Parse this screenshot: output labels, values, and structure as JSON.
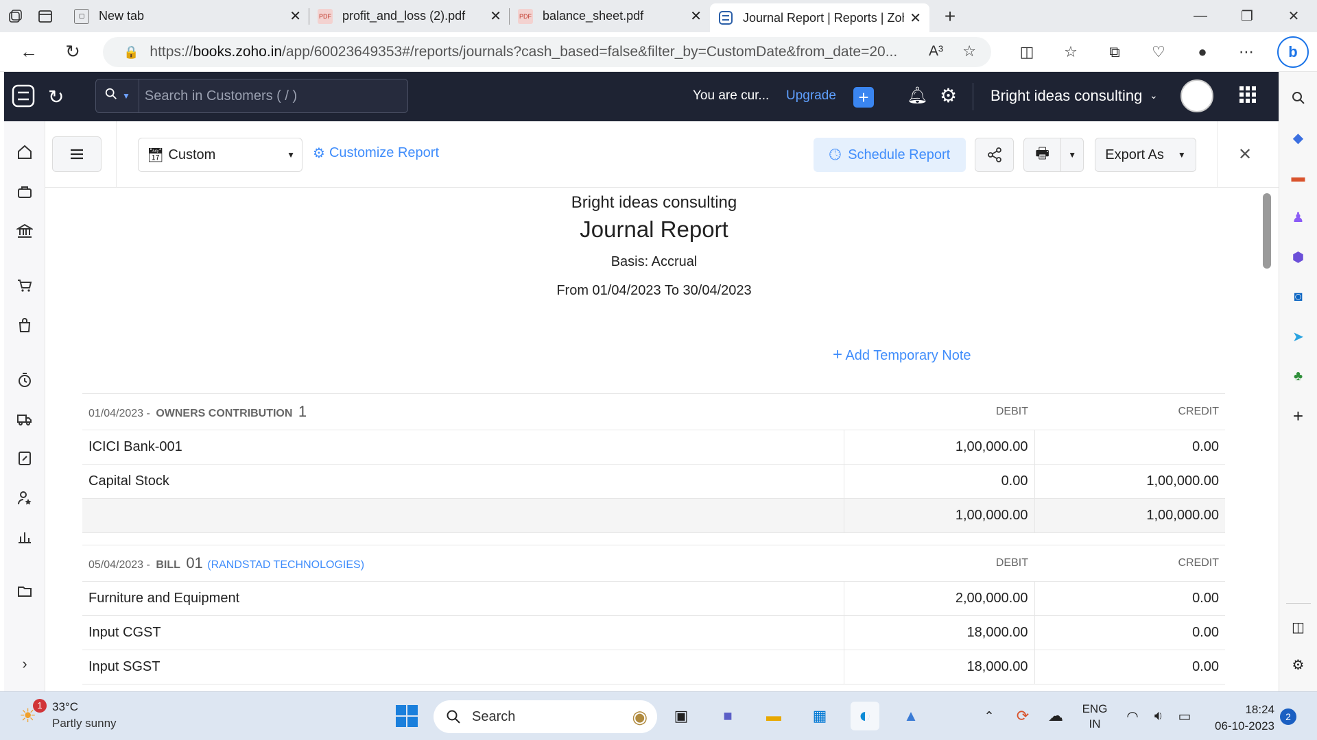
{
  "browser": {
    "tabs": [
      {
        "title": "New tab"
      },
      {
        "title": "profit_and_loss (2).pdf",
        "fav": "PDF"
      },
      {
        "title": "balance_sheet.pdf",
        "fav": "PDF"
      },
      {
        "title": "Journal Report | Reports | Zoho B"
      }
    ],
    "url_prefix": "https://",
    "url_domain": "books.zoho.in",
    "url_rest": "/app/60023649353#/reports/journals?cash_based=false&filter_by=CustomDate&from_date=20...",
    "read_aloud": "A³"
  },
  "app": {
    "search_placeholder": "Search in Customers ( / )",
    "trial_text": "You are cur...",
    "upgrade_label": "Upgrade",
    "org_name": "Bright ideas consulting"
  },
  "toolbar": {
    "date_filter": "Custom",
    "customize_label": "Customize Report",
    "schedule_label": "Schedule Report",
    "export_label": "Export As"
  },
  "report": {
    "org": "Bright ideas consulting",
    "title": "Journal Report",
    "basis": "Basis: Accrual",
    "period": "From 01/04/2023 To 30/04/2023",
    "add_note": "Add Temporary Note",
    "debit_header": "DEBIT",
    "credit_header": "CREDIT",
    "entries": [
      {
        "date": "01/04/2023 -",
        "type": "OWNERS CONTRIBUTION",
        "number": "1",
        "party": "",
        "rows": [
          {
            "account": "ICICI Bank-001",
            "debit": "1,00,000.00",
            "credit": "0.00"
          },
          {
            "account": "Capital Stock",
            "debit": "0.00",
            "credit": "1,00,000.00"
          }
        ],
        "total_debit": "1,00,000.00",
        "total_credit": "1,00,000.00"
      },
      {
        "date": "05/04/2023 -",
        "type": "BILL",
        "number": "01",
        "party": "(RANDSTAD TECHNOLOGIES)",
        "rows": [
          {
            "account": "Furniture and Equipment",
            "debit": "2,00,000.00",
            "credit": "0.00"
          },
          {
            "account": "Input CGST",
            "debit": "18,000.00",
            "credit": "0.00"
          },
          {
            "account": "Input SGST",
            "debit": "18,000.00",
            "credit": "0.00"
          }
        ]
      }
    ]
  },
  "taskbar": {
    "weather_badge": "1",
    "temp": "33°C",
    "condition": "Partly sunny",
    "search_label": "Search",
    "lang1": "ENG",
    "lang2": "IN",
    "time": "18:24",
    "date": "06-10-2023",
    "notif_count": "2"
  },
  "colors": {
    "header_bg": "#1e2333",
    "accent": "#408dfb",
    "upgrade_btn": "#3a85f0"
  }
}
